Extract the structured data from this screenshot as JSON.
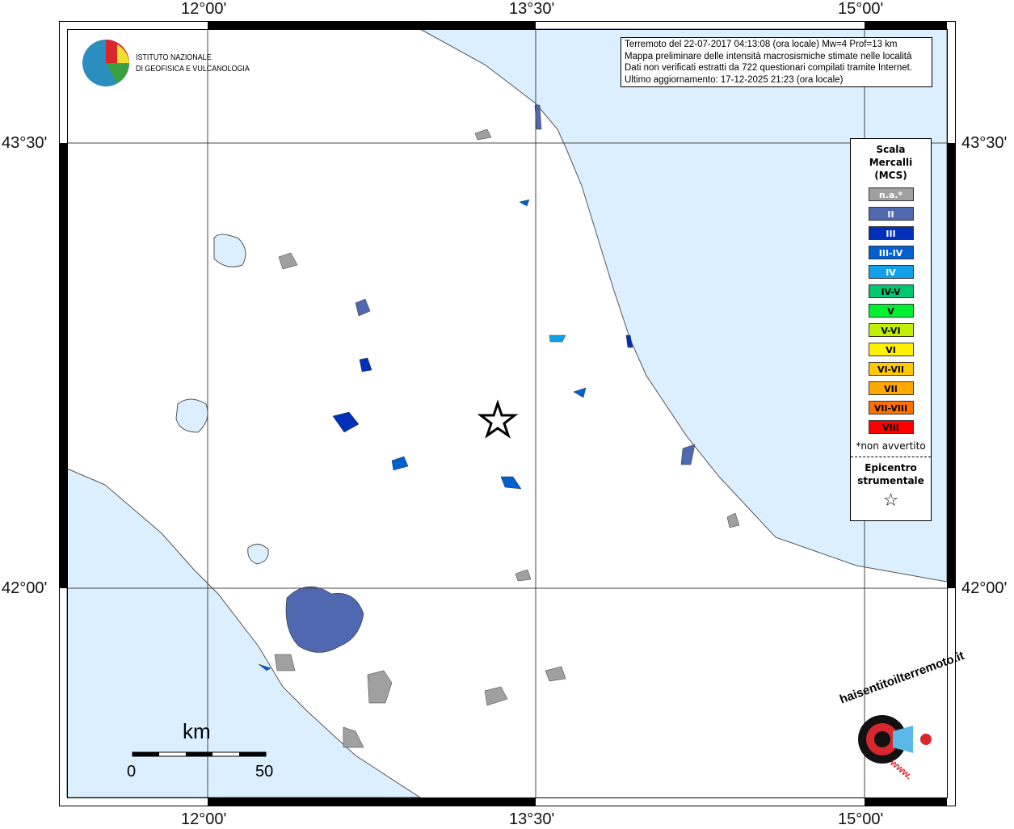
{
  "axes": {
    "lon_labels": [
      "12°00'",
      "13°30'",
      "15°00'"
    ],
    "lat_labels": [
      "43°30'",
      "42°00'"
    ]
  },
  "info": {
    "lines": [
      "Terremoto del 22-07-2017 04:13:08 (ora locale) Mw=4 Prof=13 km",
      "Mappa preliminare delle intensità macrosismiche stimate nelle località",
      "Dati non verificati estratti da 722 questionari compilati tramite Internet.",
      "Ultimo aggiornamento: 17-12-2025 21:23 (ora locale)"
    ]
  },
  "ingv": {
    "line1": "ISTITUTO NAZIONALE",
    "line2": "DI GEOFISICA E VULCANOLOGIA"
  },
  "legend": {
    "title": [
      "Scala",
      "Mercalli",
      "(MCS)"
    ],
    "items": [
      {
        "label": "n.a.*",
        "color": "#a0a0a0",
        "text": "#fff"
      },
      {
        "label": "II",
        "color": "#5068b0",
        "text": "#fff"
      },
      {
        "label": "III",
        "color": "#0030b8",
        "text": "#fff"
      },
      {
        "label": "III-IV",
        "color": "#0060d0",
        "text": "#fff"
      },
      {
        "label": "IV",
        "color": "#10a0e8",
        "text": "#fff"
      },
      {
        "label": "IV-V",
        "color": "#00c870",
        "text": "#000"
      },
      {
        "label": "V",
        "color": "#00f030",
        "text": "#000"
      },
      {
        "label": "V-VI",
        "color": "#c0f000",
        "text": "#000"
      },
      {
        "label": "VI",
        "color": "#fff000",
        "text": "#000"
      },
      {
        "label": "VI-VII",
        "color": "#ffc800",
        "text": "#000"
      },
      {
        "label": "VII",
        "color": "#ffa800",
        "text": "#000"
      },
      {
        "label": "VII-VIII",
        "color": "#ff7000",
        "text": "#000"
      },
      {
        "label": "VIII",
        "color": "#ff0000",
        "text": "#000"
      }
    ],
    "note": "*non avvertito",
    "epi": [
      "Epicentro",
      "strumentale"
    ],
    "star": "☆"
  },
  "scale": {
    "unit": "km",
    "min": "0",
    "max": "50"
  },
  "hst": {
    "text": "haisentitoilterremoto.it",
    "www": "www."
  },
  "colors": {
    "sea": "#dcefff"
  }
}
